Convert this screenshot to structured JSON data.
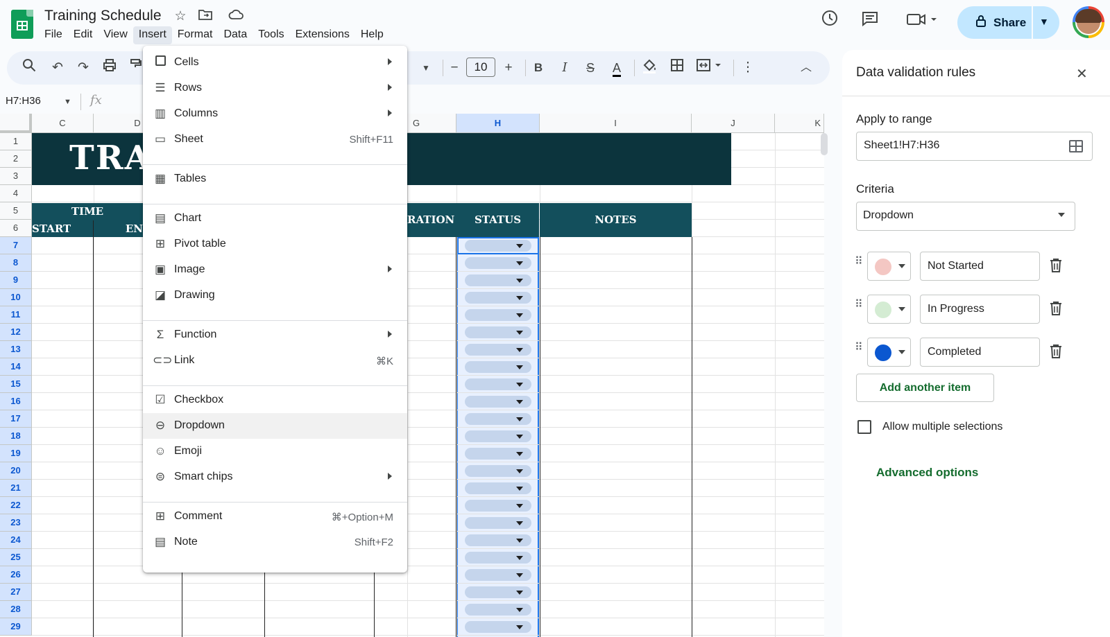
{
  "app": {
    "doc_title": "Training Schedule",
    "menus": [
      "File",
      "Edit",
      "View",
      "Insert",
      "Format",
      "Data",
      "Tools",
      "Extensions",
      "Help"
    ],
    "active_menu": "Insert",
    "share_label": "Share"
  },
  "toolbar": {
    "font_size": "10",
    "name_box": "H7:H36",
    "fx": "fx"
  },
  "grid": {
    "columns": [
      "C",
      "D",
      "G",
      "H",
      "I",
      "J",
      "K"
    ],
    "selected_column": "H",
    "rows": [
      "1",
      "2",
      "3",
      "4",
      "5",
      "6",
      "7",
      "8",
      "9",
      "10",
      "11",
      "12",
      "13",
      "14",
      "15",
      "16",
      "17",
      "18",
      "19",
      "20",
      "21",
      "22",
      "23",
      "24",
      "25",
      "26",
      "27",
      "28",
      "29"
    ],
    "banner_text": "TRAI",
    "header_time": "TIME",
    "header_start": "START",
    "header_end": "EN",
    "header_duration": "RATION",
    "header_status": "STATUS",
    "header_notes": "NOTES"
  },
  "insert_menu": {
    "items": [
      {
        "label": "Cells",
        "icon": "cells-icon",
        "submenu": true
      },
      {
        "label": "Rows",
        "icon": "rows-icon",
        "submenu": true
      },
      {
        "label": "Columns",
        "icon": "columns-icon",
        "submenu": true
      },
      {
        "label": "Sheet",
        "icon": "sheet-icon",
        "shortcut": "Shift+F11"
      },
      {
        "label": "Tables",
        "icon": "tables-icon"
      },
      {
        "label": "Chart",
        "icon": "chart-icon"
      },
      {
        "label": "Pivot table",
        "icon": "pivot-table-icon"
      },
      {
        "label": "Image",
        "icon": "image-icon",
        "submenu": true
      },
      {
        "label": "Drawing",
        "icon": "drawing-icon"
      },
      {
        "label": "Function",
        "icon": "sigma-icon",
        "submenu": true
      },
      {
        "label": "Link",
        "icon": "link-icon",
        "shortcut": "⌘K"
      },
      {
        "label": "Checkbox",
        "icon": "checkbox-icon"
      },
      {
        "label": "Dropdown",
        "icon": "dropdown-icon",
        "highlighted": true
      },
      {
        "label": "Emoji",
        "icon": "emoji-icon"
      },
      {
        "label": "Smart chips",
        "icon": "smart-chips-icon",
        "submenu": true
      },
      {
        "label": "Comment",
        "icon": "comment-icon",
        "shortcut": "⌘+Option+M"
      },
      {
        "label": "Note",
        "icon": "note-icon",
        "shortcut": "Shift+F2"
      }
    ]
  },
  "validation_panel": {
    "title": "Data validation rules",
    "apply_label": "Apply to range",
    "range": "Sheet1!H7:H36",
    "criteria_label": "Criteria",
    "criteria_value": "Dropdown",
    "items": [
      {
        "value": "Not Started",
        "color": "#f4c7c3"
      },
      {
        "value": "In Progress",
        "color": "#d4ecd3"
      },
      {
        "value": "Completed",
        "color": "#0b57d0"
      }
    ],
    "add_item": "Add another item",
    "allow_multiple": "Allow multiple selections",
    "advanced": "Advanced options"
  },
  "colors": {
    "banner": "#0c343d",
    "header": "#134f5c",
    "accent_green": "#146c2e",
    "selection_blue": "#1a73e8"
  }
}
